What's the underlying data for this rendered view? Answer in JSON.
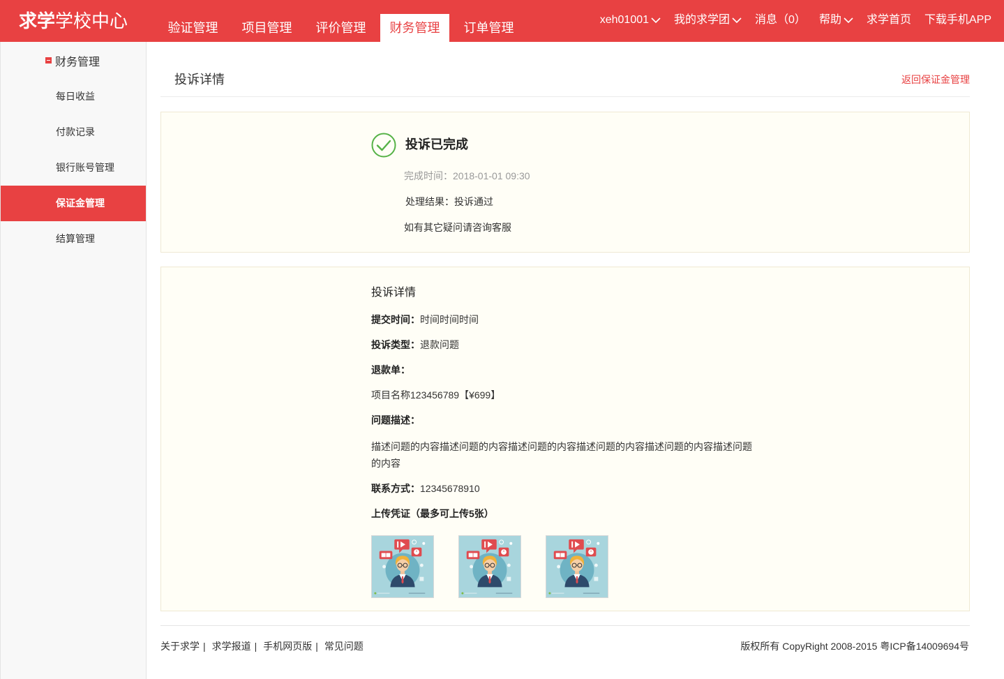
{
  "theme": {
    "primary": "#e84142",
    "success": "#55b246",
    "box_bg": "#fffef6",
    "box_border": "#efe9d3"
  },
  "header": {
    "logo_bold": "求学",
    "logo_rest": "学校中心",
    "nav": [
      {
        "label": "验证管理",
        "active": false
      },
      {
        "label": "项目管理",
        "active": false
      },
      {
        "label": "评价管理",
        "active": false
      },
      {
        "label": "财务管理",
        "active": true
      },
      {
        "label": "订单管理",
        "active": false
      }
    ],
    "topnav": {
      "user": "xeh01001",
      "group": "我的求学团",
      "messages": "消息（0）",
      "help": "帮助",
      "home": "求学首页",
      "download": "下载手机APP"
    }
  },
  "sidebar": {
    "section": "财务管理",
    "items": [
      {
        "label": "每日收益",
        "active": false
      },
      {
        "label": "付款记录",
        "active": false
      },
      {
        "label": "银行账号管理",
        "active": false
      },
      {
        "label": "保证金管理",
        "active": true
      },
      {
        "label": "结算管理",
        "active": false
      }
    ]
  },
  "page": {
    "title": "投诉详情",
    "back_link": "返回保证金管理"
  },
  "status": {
    "icon": "check-circle-icon",
    "title": "投诉已完成",
    "time_label": "完成时间：",
    "time_value": "2018-01-01 09:30",
    "result_label": "处理结果：",
    "result_value": "投诉通过",
    "note": "如有其它疑问请咨询客服"
  },
  "detail": {
    "title": "投诉详情",
    "submit_label": "提交时间：",
    "submit_value": "时间时间时间",
    "type_label": "投诉类型：",
    "type_value": "退款问题",
    "refund_label": "退款单：",
    "refund_item": "项目名称123456789【¥699】",
    "desc_label": "问题描述：",
    "desc_text": "描述问题的内容描述问题的内容描述问题的内容描述问题的内容描述问题的内容描述问题的内容",
    "contact_label": "联系方式：",
    "contact_value": "12345678910",
    "upload_label": "上传凭证（最多可上传5张）",
    "images": [
      "teacher-illustration",
      "teacher-illustration",
      "teacher-illustration"
    ]
  },
  "footer": {
    "links": [
      "关于求学",
      "求学报道",
      "手机网页版",
      "常见问题"
    ],
    "separator": "|",
    "copyright": "版权所有 CopyRight 2008-2015 粤ICP备14009694号"
  }
}
